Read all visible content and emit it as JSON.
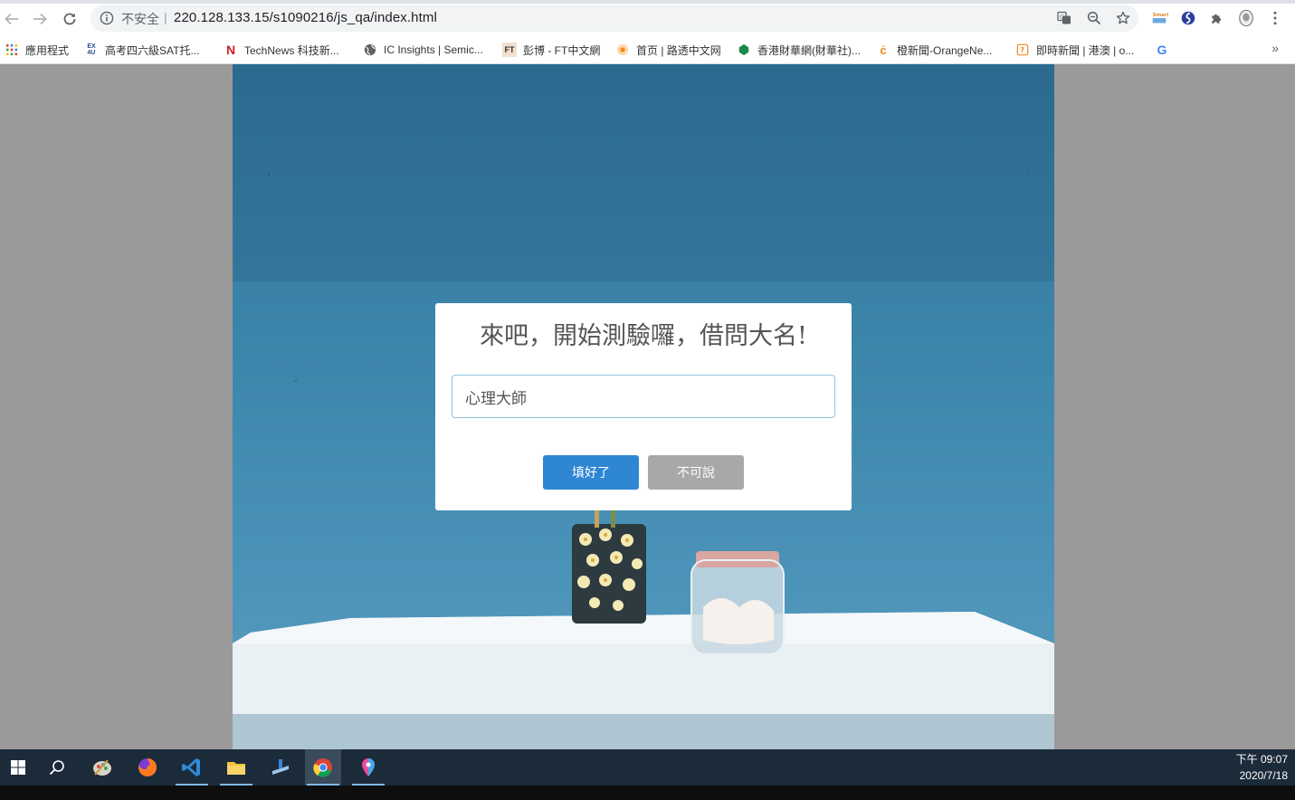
{
  "browser": {
    "security_label": "不安全",
    "separator": "|",
    "url": "220.128.133.15/s1090216/js_qa/index.html",
    "icons": {
      "back": "arrow-left-icon",
      "forward": "arrow-right-icon",
      "reload": "reload-icon",
      "info": "info-icon",
      "translate": "translate-icon",
      "zoom": "zoom-icon",
      "star": "star-icon",
      "extensions": "puzzle-icon",
      "menu": "kebab-menu-icon"
    }
  },
  "bookmarks": {
    "items": [
      {
        "label": "應用程式",
        "icon": "apps-grid-icon"
      },
      {
        "label": "高考四六級SAT托...",
        "icon": "exam4us-icon"
      },
      {
        "label": "TechNews 科技新...",
        "icon": "technews-icon"
      },
      {
        "label": "IC Insights | Semic...",
        "icon": "globe-icon"
      },
      {
        "label": "彭博 - FT中文網",
        "icon": "ft-icon"
      },
      {
        "label": "首页 | 路透中文网",
        "icon": "reuters-icon"
      },
      {
        "label": "香港財華網(財華社)...",
        "icon": "finet-icon"
      },
      {
        "label": "橙新聞-OrangeNe...",
        "icon": "orange-news-icon"
      },
      {
        "label": "即時新聞 | 港澳 | o...",
        "icon": "news-icon"
      },
      {
        "label": "",
        "icon": "google-icon"
      }
    ],
    "more": "»"
  },
  "modal": {
    "title": "來吧，開始測驗囉，借問大名!",
    "input_value": "心理大師",
    "input_placeholder": "",
    "confirm_label": "填好了",
    "cancel_label": "不可說"
  },
  "colors": {
    "confirm_button": "#2f86d3",
    "cancel_button": "#a8a8a8",
    "page_background": "#9a9a9a",
    "taskbar": "#1c2b3a"
  },
  "taskbar": {
    "apps": [
      "windows-start-icon",
      "search-icon",
      "paint-icon",
      "firefox-icon",
      "vscode-icon",
      "file-explorer-icon",
      "installer-icon",
      "chrome-icon",
      "maps-pin-icon"
    ],
    "time": "下午 09:07",
    "date": "2020/7/18"
  }
}
